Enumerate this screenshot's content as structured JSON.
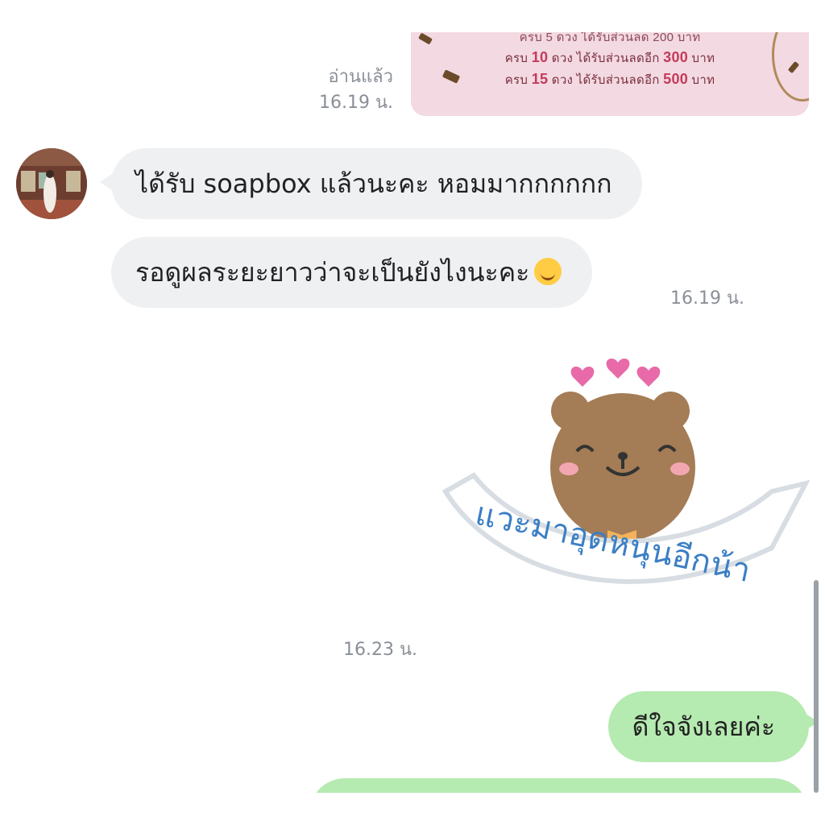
{
  "promo": {
    "line1": "ครบ 5 ดวง ได้รับส่วนลด 200 บาท",
    "line2_prefix": "ครบ ",
    "line2_count": "10",
    "line2_mid": " ดวง ได้รับส่วนลดอีก ",
    "line2_amount": "300",
    "line2_suffix": " บาท",
    "line3_prefix": "ครบ ",
    "line3_count": "15",
    "line3_mid": " ดวง ได้รับส่วนลดอีก ",
    "line3_amount": "500",
    "line3_suffix": " บาท"
  },
  "read_status": {
    "label": "อ่านแล้ว",
    "time": "16.19 น."
  },
  "incoming": [
    {
      "text": "ได้รับ soapbox แล้วนะคะ หอมมากกกกกก"
    },
    {
      "text": "รอดูผลระยะยาวว่าจะเป็นยังไงนะคะ",
      "time": "16.19 น."
    }
  ],
  "sticker": {
    "caption": "แวะมาอุดหนุนอีกน้า",
    "time": "16.23 น."
  },
  "outgoing": [
    {
      "text": "ดีใจจังเลยค่ะ"
    }
  ],
  "colors": {
    "incoming_bubble": "#eef0f2",
    "outgoing_bubble": "#b5eab0",
    "meta_text": "#8a8f98",
    "promo_bg": "#f3d9e2"
  },
  "icons": {
    "emoji": "smiling-face-icon",
    "sticker": "bear-sticker"
  }
}
